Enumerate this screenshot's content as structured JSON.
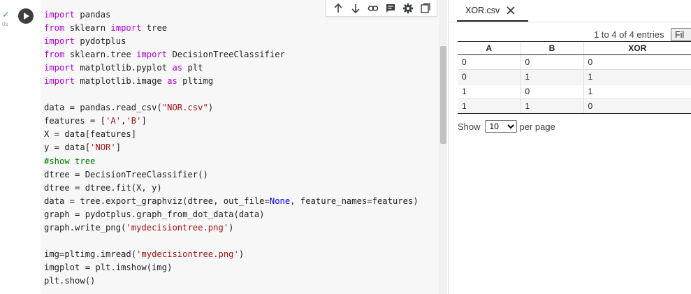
{
  "cell": {
    "status_check": "✓",
    "run_time": "0s",
    "lines": [
      [
        {
          "t": "import",
          "c": "kw"
        },
        {
          "t": " pandas"
        }
      ],
      [
        {
          "t": "from",
          "c": "kw"
        },
        {
          "t": " sklearn "
        },
        {
          "t": "import",
          "c": "kw"
        },
        {
          "t": " tree"
        }
      ],
      [
        {
          "t": "import",
          "c": "kw"
        },
        {
          "t": " pydotplus"
        }
      ],
      [
        {
          "t": "from",
          "c": "kw"
        },
        {
          "t": " sklearn.tree "
        },
        {
          "t": "import",
          "c": "kw"
        },
        {
          "t": " DecisionTreeClassifier"
        }
      ],
      [
        {
          "t": "import",
          "c": "kw"
        },
        {
          "t": " matplotlib.pyplot "
        },
        {
          "t": "as",
          "c": "kw"
        },
        {
          "t": " plt"
        }
      ],
      [
        {
          "t": "import",
          "c": "kw"
        },
        {
          "t": " matplotlib.image "
        },
        {
          "t": "as",
          "c": "kw"
        },
        {
          "t": " pltimg"
        }
      ],
      [],
      [
        {
          "t": "data = pandas.read_csv("
        },
        {
          "t": "\"NOR.csv\"",
          "c": "str"
        },
        {
          "t": ")"
        }
      ],
      [
        {
          "t": "features = ["
        },
        {
          "t": "'A'",
          "c": "str"
        },
        {
          "t": ","
        },
        {
          "t": "'B'",
          "c": "str"
        },
        {
          "t": "]"
        }
      ],
      [
        {
          "t": "X = data[features]"
        }
      ],
      [
        {
          "t": "y = data["
        },
        {
          "t": "'NOR'",
          "c": "str"
        },
        {
          "t": "]"
        }
      ],
      [
        {
          "t": "#show tree",
          "c": "cmt"
        }
      ],
      [
        {
          "t": "dtree = DecisionTreeClassifier()"
        }
      ],
      [
        {
          "t": "dtree = dtree.fit(X, y)"
        }
      ],
      [
        {
          "t": "data = tree.export_graphviz(dtree, out_file="
        },
        {
          "t": "None",
          "c": "bi"
        },
        {
          "t": ", feature_names=features)"
        }
      ],
      [
        {
          "t": "graph = pydotplus.graph_from_dot_data(data)"
        }
      ],
      [
        {
          "t": "graph.write_png("
        },
        {
          "t": "'mydecisiontree.png'",
          "c": "str"
        },
        {
          "t": ")"
        }
      ],
      [],
      [
        {
          "t": "img=pltimg.imread("
        },
        {
          "t": "'mydecisiontree.png'",
          "c": "str"
        },
        {
          "t": ")"
        }
      ],
      [
        {
          "t": "imgplot = plt.imshow(img)"
        }
      ],
      [
        {
          "t": "plt.show()"
        }
      ]
    ]
  },
  "toolbar": {
    "icons": [
      "move-up-icon",
      "move-down-icon",
      "link-icon",
      "comment-icon",
      "settings-icon",
      "mirror-cell-icon"
    ]
  },
  "file_viewer": {
    "tab_label": "XOR.csv",
    "entries_info": "1 to 4 of 4 entries",
    "filter_label": "Fil",
    "columns": [
      "A",
      "B",
      "XOR"
    ],
    "rows": [
      [
        "0",
        "0",
        "0"
      ],
      [
        "0",
        "1",
        "1"
      ],
      [
        "1",
        "0",
        "1"
      ],
      [
        "1",
        "1",
        "0"
      ]
    ],
    "paging": {
      "show_label": "Show",
      "page_size": "10",
      "per_page_label": "per page"
    }
  },
  "colors": {
    "keyword": "#af00db",
    "string": "#a31515",
    "comment": "#008000",
    "builtin": "#0000ff",
    "run_ok": "#3c9d4a"
  }
}
